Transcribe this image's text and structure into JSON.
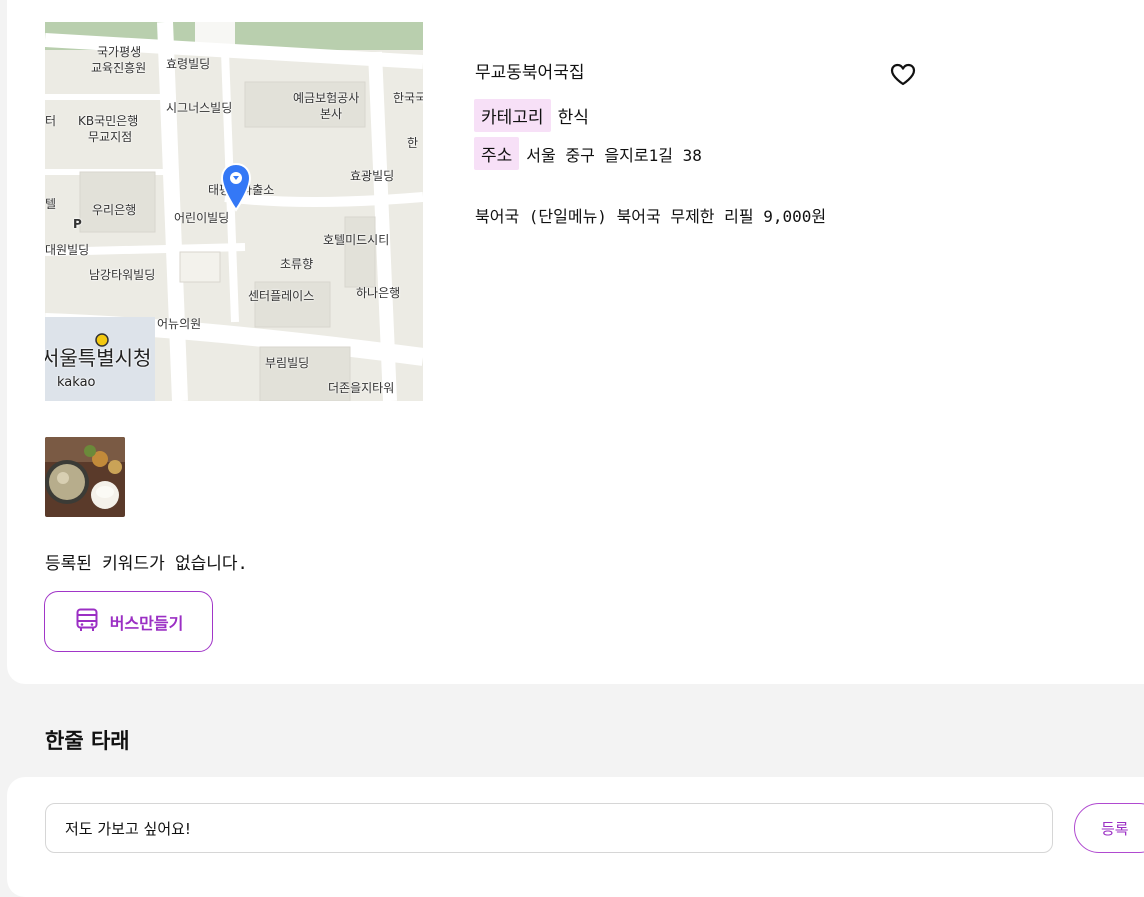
{
  "map": {
    "labels": {
      "l1": "국가평생",
      "l2": "교육진흥원",
      "l3": "효령빌딩",
      "l4": "시그너스빌딩",
      "l5": "예금보험공사",
      "l6": "본사",
      "l7": "한국국",
      "l8": "KB국민은행",
      "l9": "무교지점",
      "l10": "터",
      "l11": "한",
      "l12": "효광빌딩",
      "l13": "태평로파출소",
      "l14": "우리은행",
      "l15": "어린이빌딩",
      "l16": "호텔미드시티",
      "l17": "대원빌딩",
      "l18": "초류향",
      "l19": "남강타워빌딩",
      "l20": "센터플레이스",
      "l21": "하나은행",
      "l22": "어뉴의원",
      "l23": "서울특별시청",
      "l24": "부림빌딩",
      "l25": "kakao",
      "l26": "더존을지타워",
      "l27": "텔",
      "l28": "P"
    }
  },
  "restaurant": {
    "name": "무교동북어국집",
    "category_tag": "카테고리",
    "category_value": "한식",
    "address_tag": "주소",
    "address_value": "서울 중구 을지로1길 38",
    "menu": "북어국 (단일메뉴) 북어국 무제한 리필 9,000원"
  },
  "keywords": {
    "empty_text": "등록된 키워드가 없습니다."
  },
  "bus_button": {
    "label": "버스만들기"
  },
  "comments": {
    "section_title": "한줄 타래",
    "input_value": "저도 가보고 싶어요!",
    "submit_label": "등록"
  },
  "colors": {
    "accent": "#9b2fc4",
    "tag_bg": "#f7e0f7",
    "pin": "#3478f6"
  },
  "icons": {
    "heart": "heart-icon",
    "bus": "bus-icon",
    "pin": "map-pin-icon"
  }
}
